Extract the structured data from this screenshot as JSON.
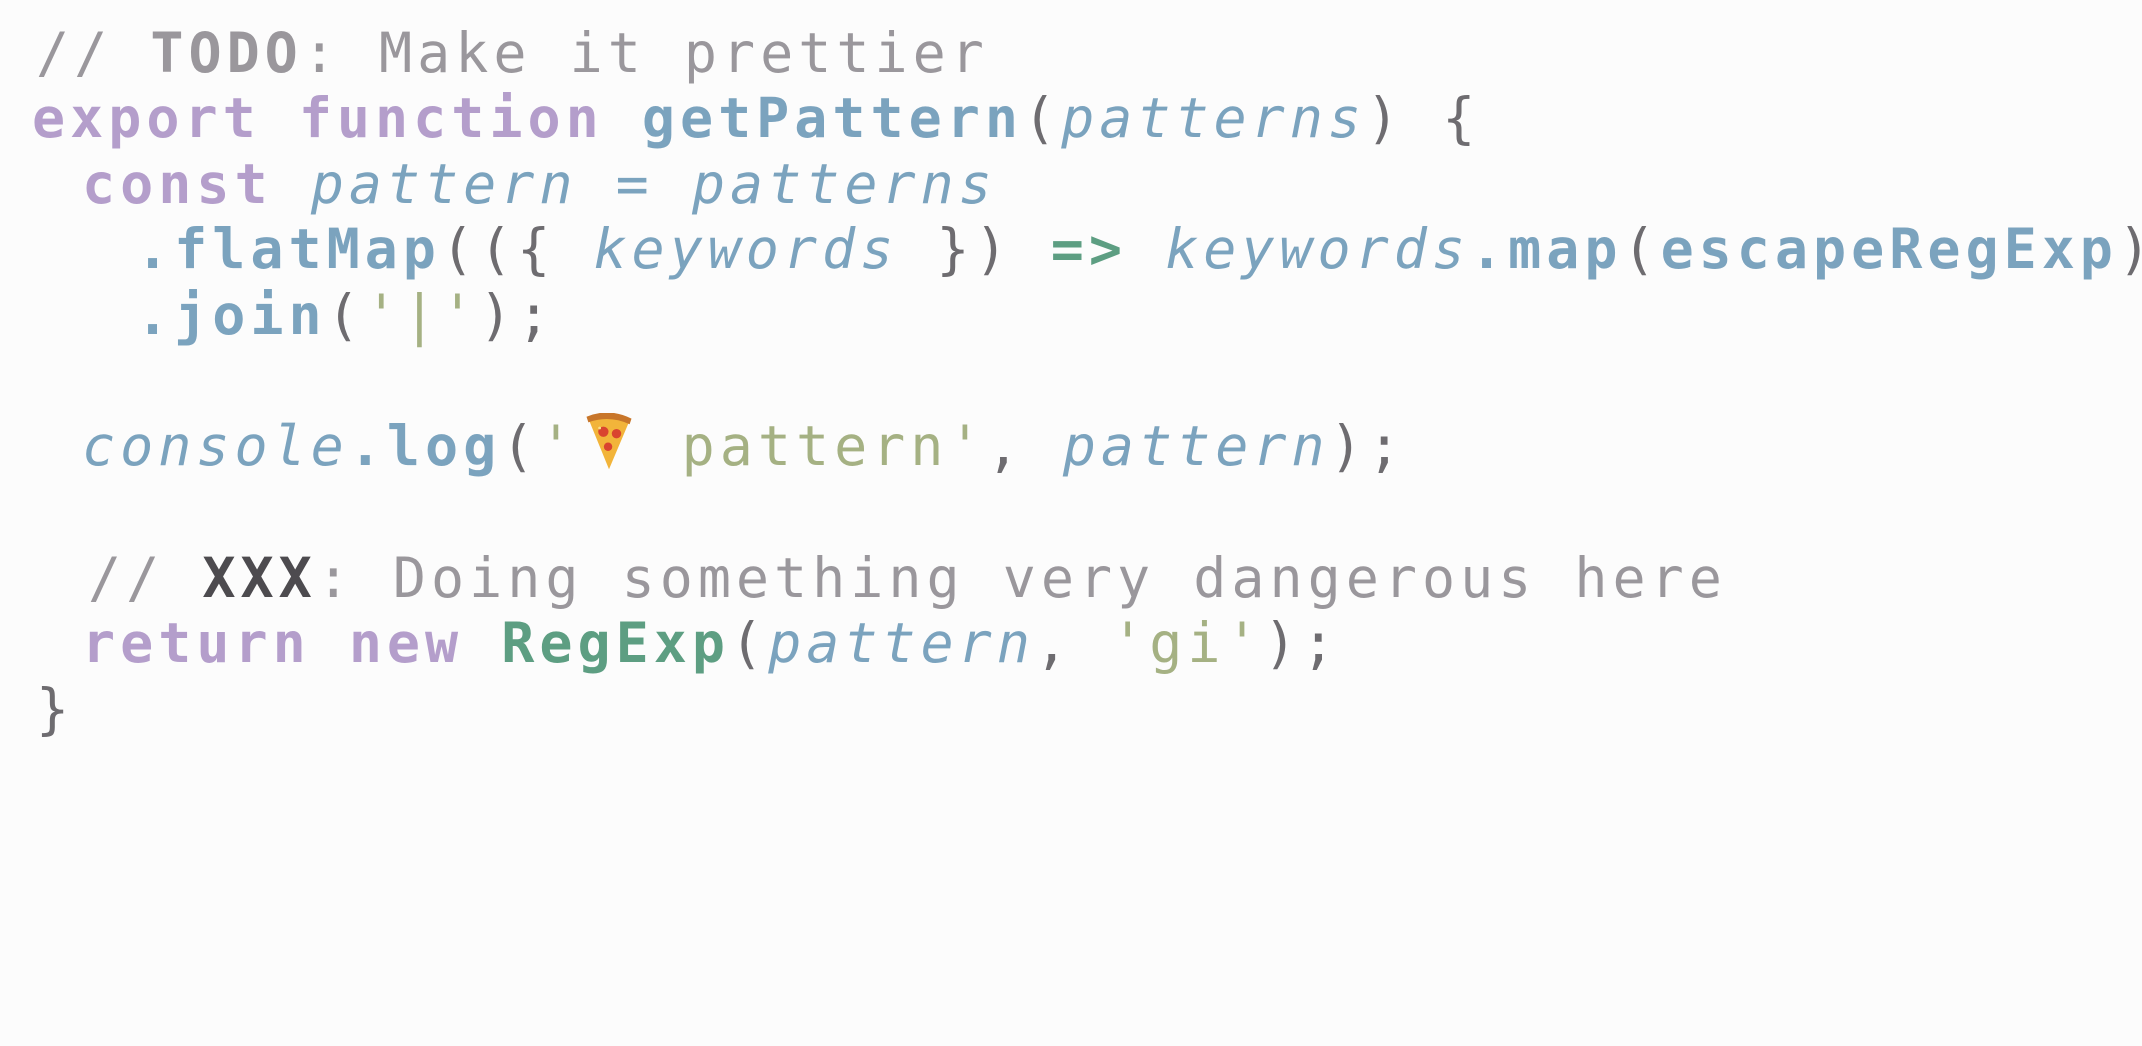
{
  "code": {
    "lines": [
      {
        "indent": 1,
        "tokens": [
          {
            "t": "comment",
            "v": "// "
          },
          {
            "t": "todo",
            "v": "TODO"
          },
          {
            "t": "comment",
            "v": ": Make it prettier"
          }
        ]
      },
      {
        "indent": 0,
        "tokens": [
          {
            "t": "kw",
            "v": "export"
          },
          {
            "t": "punct",
            "v": " "
          },
          {
            "t": "kw",
            "v": "function"
          },
          {
            "t": "punct",
            "v": " "
          },
          {
            "t": "fn",
            "v": "getPattern"
          },
          {
            "t": "punct",
            "v": "("
          },
          {
            "t": "param",
            "v": "patterns"
          },
          {
            "t": "punct",
            "v": ") {"
          }
        ]
      },
      {
        "indent": 2,
        "tokens": [
          {
            "t": "kw",
            "v": "const"
          },
          {
            "t": "punct",
            "v": " "
          },
          {
            "t": "param",
            "v": "pattern"
          },
          {
            "t": "punct",
            "v": " "
          },
          {
            "t": "param",
            "v": "="
          },
          {
            "t": "punct",
            "v": " "
          },
          {
            "t": "param",
            "v": "patterns"
          }
        ]
      },
      {
        "indent": 4,
        "tokens": [
          {
            "t": "fn",
            "v": ".flatMap"
          },
          {
            "t": "punct",
            "v": "(({ "
          },
          {
            "t": "param",
            "v": "keywords"
          },
          {
            "t": "punct",
            "v": " }) "
          },
          {
            "t": "arrow",
            "v": "=>"
          },
          {
            "t": "punct",
            "v": " "
          },
          {
            "t": "param",
            "v": "keywords"
          },
          {
            "t": "fn",
            "v": ".map"
          },
          {
            "t": "punct",
            "v": "("
          },
          {
            "t": "fn",
            "v": "escapeRegExp"
          },
          {
            "t": "punct",
            "v": "))"
          }
        ]
      },
      {
        "indent": 4,
        "tokens": [
          {
            "t": "fn",
            "v": ".join"
          },
          {
            "t": "punct",
            "v": "("
          },
          {
            "t": "str",
            "v": "'|'"
          },
          {
            "t": "punct",
            "v": ");"
          }
        ]
      },
      {
        "indent": 0,
        "tokens": []
      },
      {
        "indent": 2,
        "tokens": [
          {
            "t": "param",
            "v": "console"
          },
          {
            "t": "fn",
            "v": ".log"
          },
          {
            "t": "punct",
            "v": "("
          },
          {
            "t": "str",
            "v": "'"
          },
          {
            "t": "emoji",
            "v": "pizza-icon"
          },
          {
            "t": "str",
            "v": " pattern'"
          },
          {
            "t": "punct",
            "v": ", "
          },
          {
            "t": "param",
            "v": "pattern"
          },
          {
            "t": "punct",
            "v": ");"
          }
        ]
      },
      {
        "indent": 0,
        "tokens": []
      },
      {
        "indent": 3,
        "tokens": [
          {
            "t": "comment",
            "v": "// "
          },
          {
            "t": "xxx",
            "v": "XXX"
          },
          {
            "t": "comment",
            "v": ": Doing something very dangerous here"
          }
        ]
      },
      {
        "indent": 2,
        "tokens": [
          {
            "t": "kw",
            "v": "return"
          },
          {
            "t": "punct",
            "v": " "
          },
          {
            "t": "kw",
            "v": "new"
          },
          {
            "t": "punct",
            "v": " "
          },
          {
            "t": "cls",
            "v": "RegExp"
          },
          {
            "t": "punct",
            "v": "("
          },
          {
            "t": "param",
            "v": "pattern"
          },
          {
            "t": "punct",
            "v": ", "
          },
          {
            "t": "str",
            "v": "'gi'"
          },
          {
            "t": "punct",
            "v": ");"
          }
        ]
      },
      {
        "indent": 1,
        "tokens": [
          {
            "t": "punct",
            "v": "}"
          }
        ]
      }
    ]
  },
  "colors": {
    "background": "#fcfcfc",
    "comment": "#9a979c",
    "keyword": "#b49ecb",
    "function": "#7ba3be",
    "string": "#a5b183",
    "class": "#5d9e82",
    "punctuation": "#6e6c70"
  }
}
